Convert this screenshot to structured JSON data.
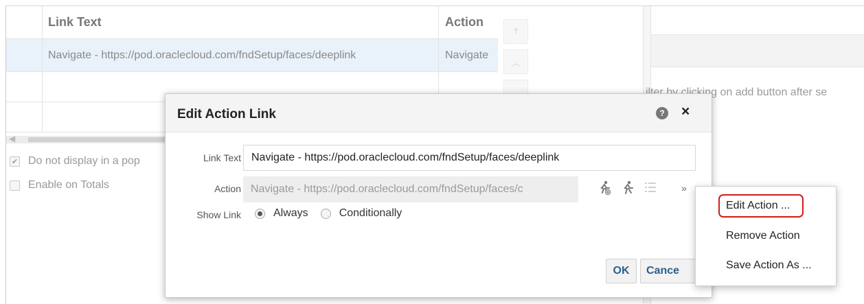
{
  "table": {
    "headers": [
      "Link Text",
      "Action"
    ],
    "rows": [
      [
        "Navigate - https://pod.oraclecloud.com/fndSetup/faces/deeplink",
        "Navigate"
      ],
      [
        "",
        ""
      ],
      [
        "",
        ""
      ]
    ]
  },
  "checkboxes": [
    {
      "label": "Do not display in a pop",
      "checked": true
    },
    {
      "label": "Enable on Totals",
      "checked": false
    }
  ],
  "right_panel": {
    "hint_text": "ilter by clicking on add button after se"
  },
  "dialog": {
    "title": "Edit Action Link",
    "help_icon": "?",
    "close_icon": "×",
    "link_text_label": "Link Text",
    "link_text_value": "Navigate - https://pod.oraclecloud.com/fndSetup/faces/deeplink",
    "action_label": "Action",
    "action_value": "Navigate - https://pod.oraclecloud.com/fndSetup/faces/c",
    "show_link_label": "Show Link",
    "show_link_options": [
      {
        "label": "Always",
        "selected": true
      },
      {
        "label": "Conditionally",
        "selected": false
      }
    ],
    "ok_label": "OK",
    "cancel_label": "Cance"
  },
  "menu": {
    "items": [
      "Edit Action ...",
      "Remove Action",
      "Save Action As ..."
    ],
    "highlighted_item": "Edit Action ...",
    "highlight_color": "#d11c1c"
  }
}
